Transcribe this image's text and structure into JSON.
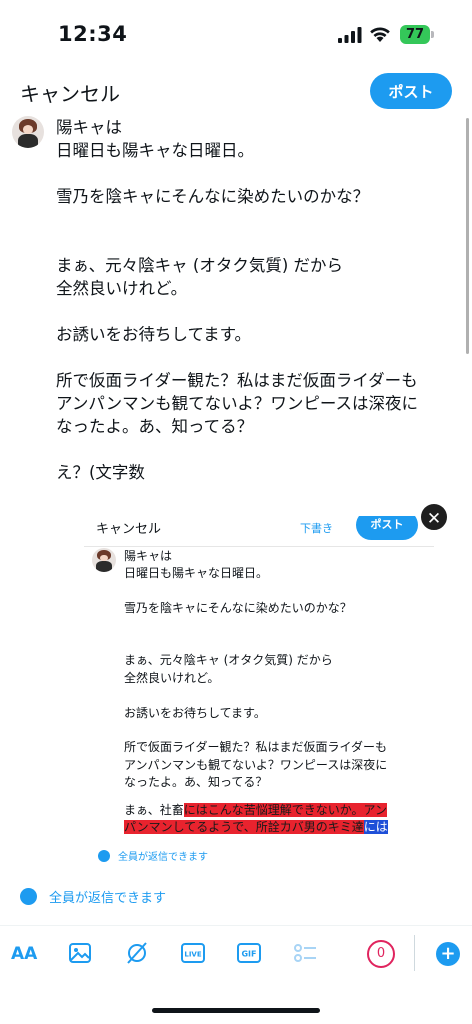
{
  "status": {
    "time": "12:34",
    "battery": "77"
  },
  "header": {
    "cancel_label": "キャンセル",
    "post_label": "ポスト"
  },
  "draft": {
    "text": "陽キャは\n日曜日も陽キャな日曜日。\n\n雪乃を陰キャにそんなに染めたいのかな？\n\n\nまぁ、元々陰キャ (オタク気質) だから\n全然良いけれど。\n\nお誘いをお待ちしてます。\n\n所で仮面ライダー観た？私はまだ仮面ライダーも\nアンパンマンも観てないよ？ワンピースは深夜に\nなったよ。あ、知ってる？\n\nえ？(文字数"
  },
  "attachment": {
    "top_cancel": "キャンセル",
    "top_draft": "下書き",
    "top_post": "ポスト",
    "text": "陽キャは\n日曜日も陽キャな日曜日。\n\n雪乃を陰キャにそんなに染めたいのかな？\n\n\nまぁ、元々陰キャ (オタク気質) だから\n全然良いけれど。\n\nお誘いをお待ちしてます。\n\n所で仮面ライダー観た？私はまだ仮面ライダーも\nアンパンマンも観てないよ？ワンピースは深夜に\nなったよ。あ、知ってる？",
    "line1_plain": "まぁ、社畜",
    "line1_highlight": "にはこんな苦悩理解できないか。アン",
    "line2_highlight": "パンマンしてるようで、所詮カバ男のキミ達",
    "line2_blue": "には",
    "reply_setting": "全員が返信できます",
    "close_symbol": "✕"
  },
  "reply_setting": {
    "label": "全員が返信できます"
  },
  "toolbar": {
    "text_format_label": "AA",
    "char_counter": "0",
    "add_symbol": "+",
    "live_label": "LIVE",
    "gif_label": "GIF"
  },
  "colors": {
    "accent": "#1d9bf0",
    "highlight_red": "#e8232e",
    "highlight_blue": "#1e4fd8",
    "counter_red": "#e0245e",
    "battery_green": "#34c759"
  }
}
